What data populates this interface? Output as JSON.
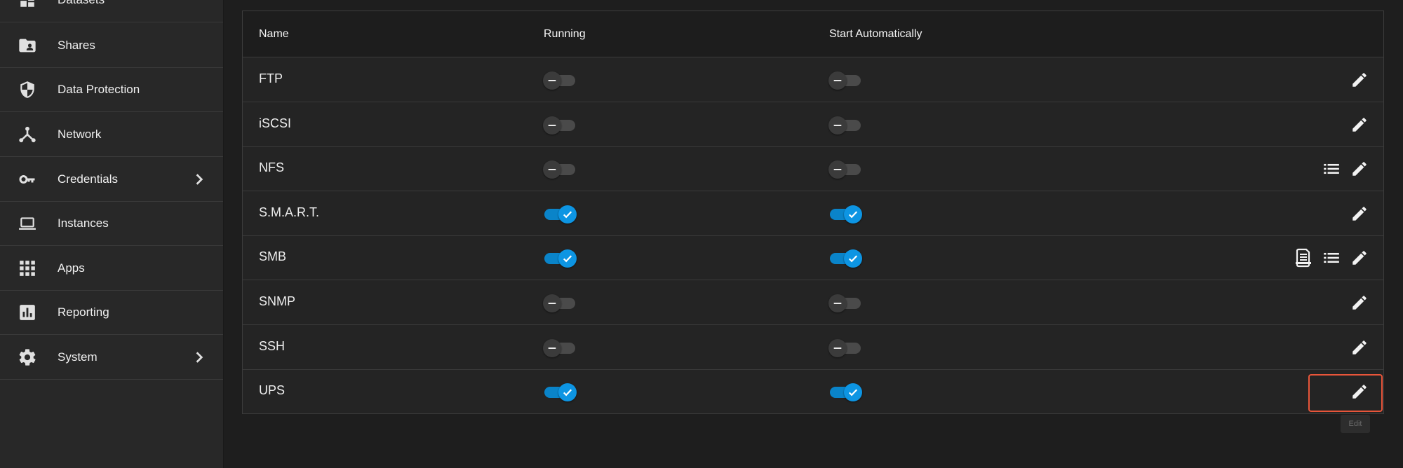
{
  "sidebar": {
    "items": [
      {
        "label": "Datasets",
        "icon": "datasets-icon"
      },
      {
        "label": "Shares",
        "icon": "shares-folder-icon"
      },
      {
        "label": "Data Protection",
        "icon": "shield-icon"
      },
      {
        "label": "Network",
        "icon": "network-icon"
      },
      {
        "label": "Credentials",
        "icon": "key-icon",
        "has_submenu": true
      },
      {
        "label": "Instances",
        "icon": "laptop-icon"
      },
      {
        "label": "Apps",
        "icon": "apps-grid-icon"
      },
      {
        "label": "Reporting",
        "icon": "reporting-chart-icon"
      },
      {
        "label": "System",
        "icon": "gear-icon",
        "has_submenu": true
      }
    ]
  },
  "table": {
    "columns": [
      "Name",
      "Running",
      "Start Automatically"
    ],
    "rows": [
      {
        "name": "FTP",
        "running": false,
        "start_automatically": false,
        "actions": [
          "edit"
        ]
      },
      {
        "name": "iSCSI",
        "running": false,
        "start_automatically": false,
        "actions": [
          "edit"
        ]
      },
      {
        "name": "NFS",
        "running": false,
        "start_automatically": false,
        "actions": [
          "list",
          "edit"
        ]
      },
      {
        "name": "S.M.A.R.T.",
        "running": true,
        "start_automatically": true,
        "actions": [
          "edit"
        ]
      },
      {
        "name": "SMB",
        "running": true,
        "start_automatically": true,
        "actions": [
          "audit-log",
          "list",
          "edit"
        ]
      },
      {
        "name": "SNMP",
        "running": false,
        "start_automatically": false,
        "actions": [
          "edit"
        ]
      },
      {
        "name": "SSH",
        "running": false,
        "start_automatically": false,
        "actions": [
          "edit"
        ]
      },
      {
        "name": "UPS",
        "running": true,
        "start_automatically": true,
        "actions": [
          "edit"
        ]
      }
    ]
  },
  "tooltip": {
    "text": "Edit"
  },
  "colors": {
    "accent": "#0d95e3",
    "highlight": "#e8553a",
    "background": "#1e1e1e",
    "sidebar": "#282828"
  }
}
